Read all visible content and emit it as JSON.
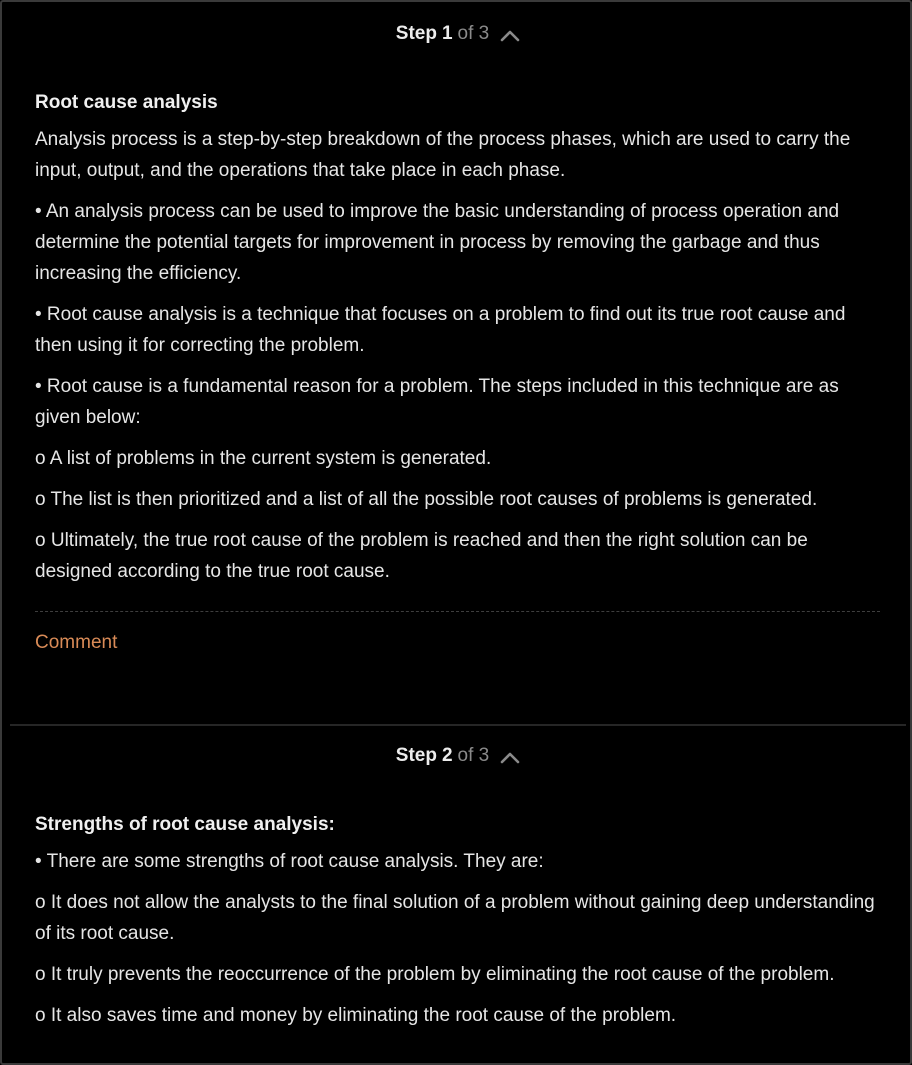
{
  "steps": [
    {
      "step_label": "Step",
      "step_number": "1",
      "step_of": "of 3",
      "chevron_icon": "chevron-up-icon",
      "heading": "Root cause analysis",
      "paragraphs": [
        "Analysis process is a step-by-step breakdown of the process phases, which are used to carry the input, output, and the operations that take place in each phase.",
        "• An analysis process can be used to improve the basic understanding of process operation and determine the potential targets for improvement in process by removing the garbage and thus increasing the efficiency.",
        "• Root cause analysis is a technique that focuses on a problem to find out its true root cause and then using it for correcting the problem.",
        "• Root cause is a fundamental reason for a problem. The steps included in this technique are as given below:",
        "o A list of problems in the current system is generated.",
        "o The list is then prioritized and a list of all the possible root causes of problems is generated.",
        "o Ultimately, the true root cause of the problem is reached and then the right solution can be designed according to the true root cause."
      ],
      "comment_label": "Comment"
    },
    {
      "step_label": "Step",
      "step_number": "2",
      "step_of": "of 3",
      "chevron_icon": "chevron-up-icon",
      "heading": "Strengths of root cause analysis:",
      "paragraphs": [
        "• There are some strengths of root cause analysis. They are:",
        "o It does not allow the analysts to the final solution of a problem without gaining deep understanding of its root cause.",
        "o It truly prevents the reoccurrence of the problem by eliminating the root cause of the problem.",
        "o It also saves time and money by eliminating the root cause of the problem."
      ]
    }
  ],
  "colors": {
    "background": "#000000",
    "text": "#e6e6e6",
    "muted": "#8a8a8a",
    "comment_link": "#d98b57",
    "border": "#3a3a3a"
  }
}
